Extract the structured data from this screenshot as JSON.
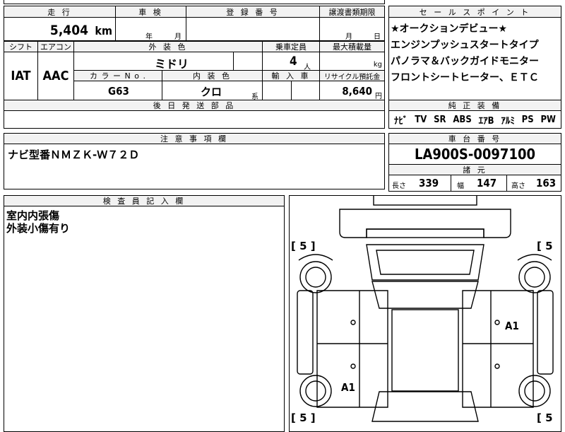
{
  "top_row": {
    "mileage": {
      "label": "走 行",
      "value": "5,404",
      "unit": "km"
    },
    "inspection": {
      "label": "車 検",
      "year_unit": "年",
      "month_unit": "月"
    },
    "registration": {
      "label": "登 録 番 号"
    },
    "transfer_deadline": {
      "label": "譲渡書類期限",
      "month_unit": "月",
      "day_unit": "日"
    }
  },
  "row2": {
    "shift": {
      "label": "シフト",
      "value": "IAT"
    },
    "aircon": {
      "label": "エアコン",
      "value": "AAC"
    },
    "exterior_color": {
      "label": "外 装 色",
      "value": "ミドリ"
    },
    "capacity": {
      "label": "乗車定員",
      "value": "4",
      "unit": "人"
    },
    "max_load": {
      "label": "最大積載量",
      "unit": "kg"
    },
    "color_no": {
      "label": "カ ラ ー N o .",
      "value": "G63"
    },
    "interior_color": {
      "label": "内 装 色",
      "value": "クロ",
      "suffix": "系"
    },
    "import": {
      "label": "輸 入 車"
    },
    "recycle": {
      "label": "リサイクル預託金",
      "value": "8,640",
      "unit": "円"
    }
  },
  "later_parts": {
    "label": "後 日 発 送 部 品"
  },
  "notes": {
    "label": "注 意 事 項 欄",
    "text": "ナビ型番ＮＭＺＫ-Ｗ７２Ｄ"
  },
  "inspector": {
    "label": "検 査 員 記 入 欄",
    "lines": [
      "室内内張傷",
      "外装小傷有り"
    ]
  },
  "sales_points": {
    "label": "セ ー ル ス ポ イ ン ト",
    "lines": [
      "★オークションデビュー★",
      "エンジンプッシュスタートタイプ",
      "パノラマ＆バックガイドモニター",
      "フロントシートヒーター、ＥＴＣ"
    ]
  },
  "equipment": {
    "label": "純 正 装 備",
    "items": [
      "ﾅﾋﾞ",
      "TV",
      "SR",
      "ABS",
      "ｴｱB",
      "ｱﾙﾐ",
      "PS",
      "PW"
    ]
  },
  "chassis": {
    "label": "車 台 番 号",
    "value": "LA900S-0097100"
  },
  "specs": {
    "label": "諸 元",
    "length_label": "長さ",
    "length": "339",
    "width_label": "幅",
    "width": "147",
    "height_label": "高さ",
    "height": "163"
  },
  "diagram": {
    "tire_fl": "5",
    "tire_fr": "5",
    "tire_rl": "5",
    "tire_rr": "5",
    "damage_right": "A1",
    "damage_left": "A1"
  }
}
